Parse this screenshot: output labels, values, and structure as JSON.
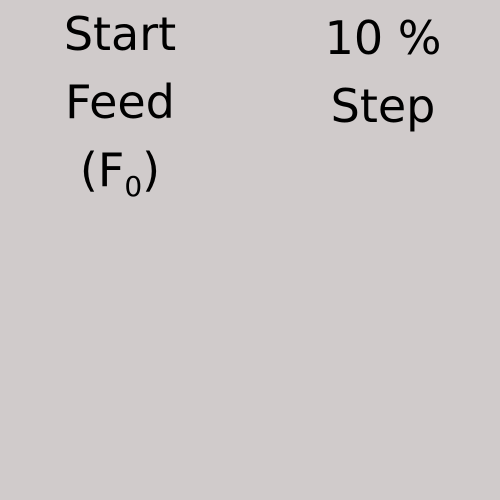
{
  "labels": {
    "start_feed": {
      "line1": "Start",
      "line2": "Feed",
      "symbol_open": "(F",
      "symbol_sub": "0",
      "symbol_close": ")"
    },
    "step": {
      "line1": "10 %",
      "line2": "Step"
    }
  },
  "colors": {
    "background": "#d0cbcb",
    "text": "#000000"
  }
}
